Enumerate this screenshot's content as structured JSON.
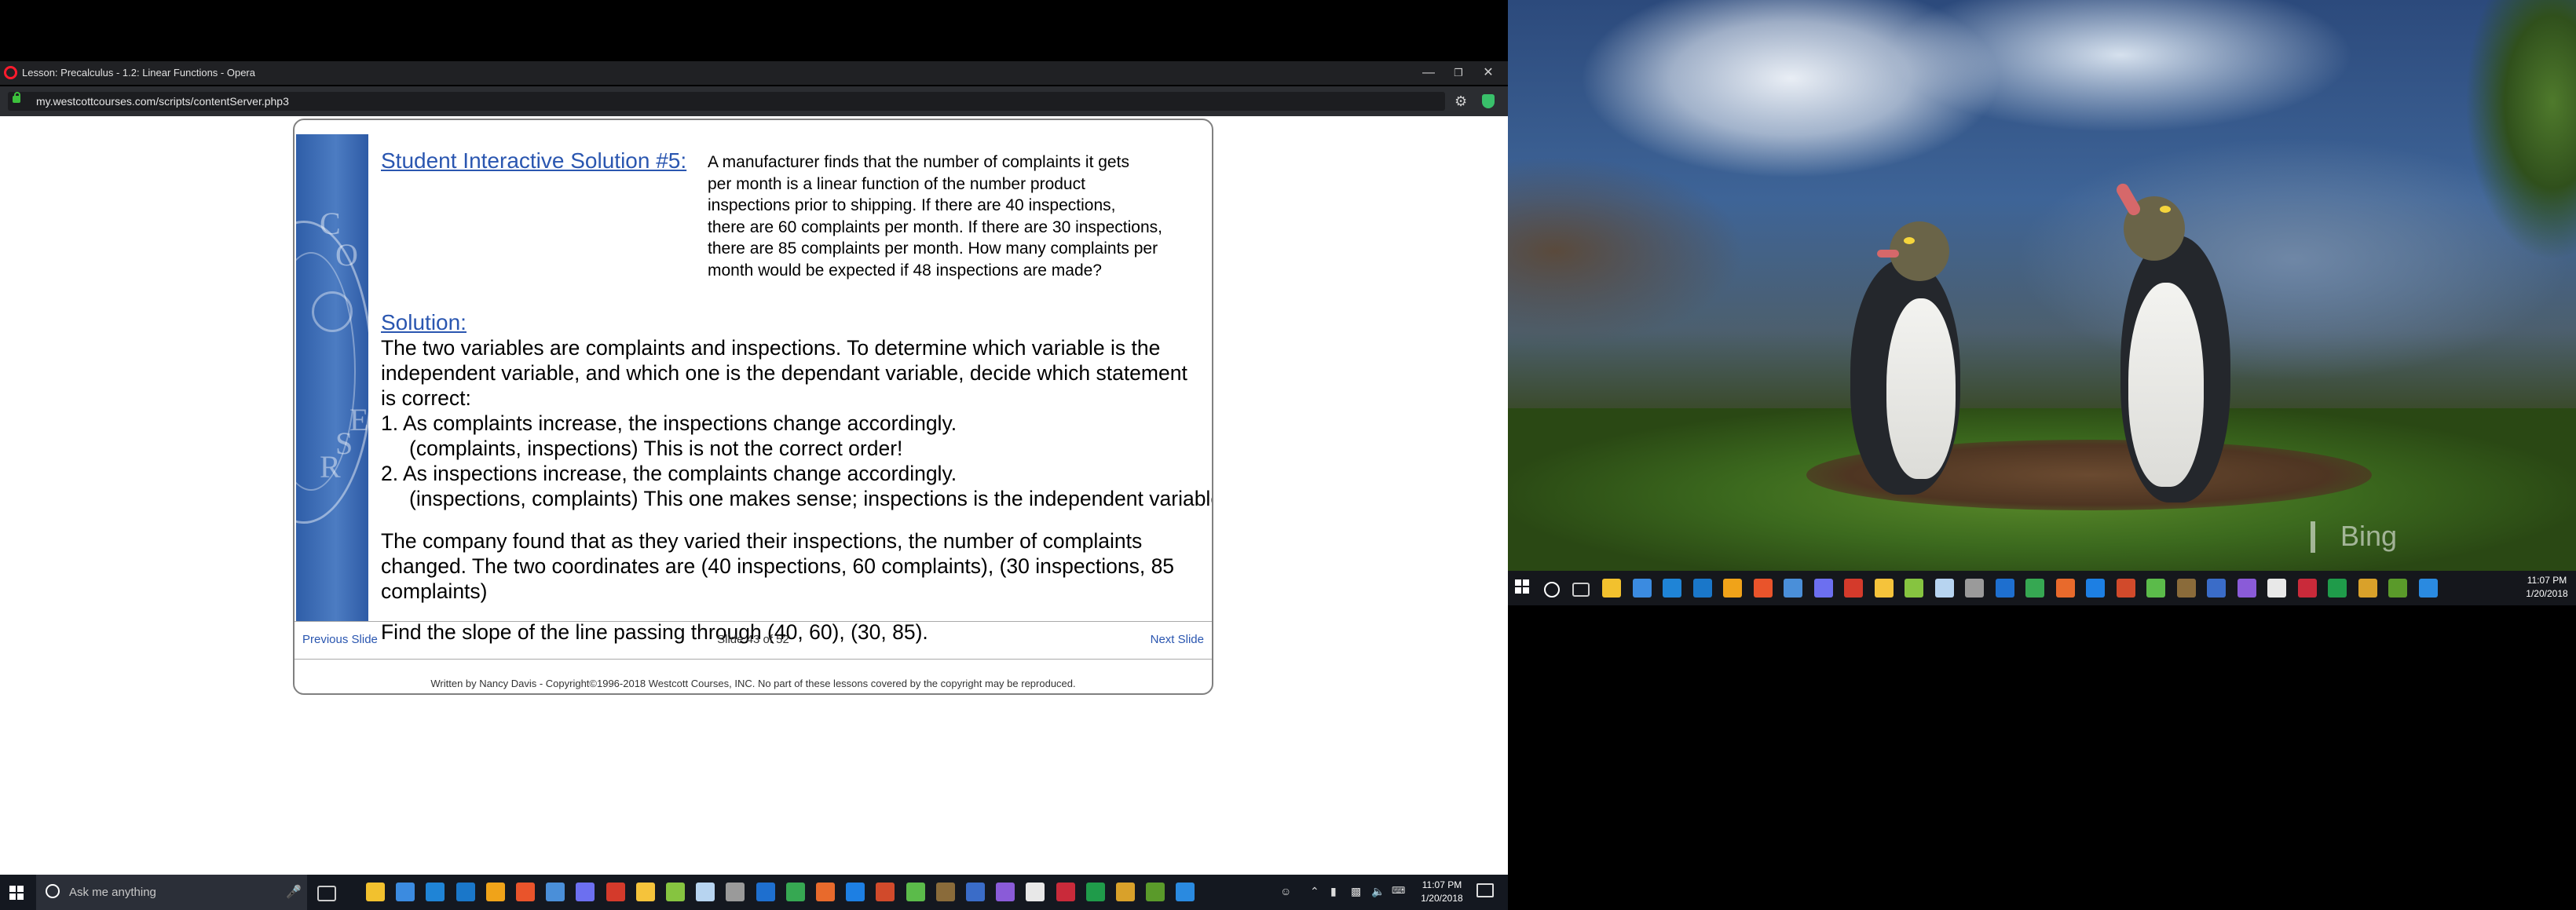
{
  "window": {
    "title": "Lesson: Precalculus - 1.2: Linear Functions - Opera",
    "url": "my.westcottcourses.com/scripts/contentServer.php3"
  },
  "lesson": {
    "sis_title": "Student Interactive Solution #5:",
    "problem_lines": [
      "A manufacturer finds that the number of complaints it gets",
      "per month is a linear function of the number product",
      "inspections prior to shipping.  If there are 40 inspections,",
      "there are 60 complaints per month.  If there are 30 inspections,",
      "there are 85 complaints per month.  How many complaints per",
      "month would be expected if 48 inspections are made?"
    ],
    "solution_label": "Solution:",
    "intro_lines": [
      "The two variables are complaints and inspections.  To determine which variable is the",
      "independent variable, and which one is the dependant variable, decide which statement",
      "is correct:"
    ],
    "option1": "1.  As complaints increase, the inspections change accordingly.",
    "option1_note": "(complaints, inspections)  This is not the correct order!",
    "option2": "2.  As inspections increase, the complaints change accordingly.",
    "option2_note": "(inspections, complaints) This one makes sense; inspections is the independent variable.",
    "company_lines": [
      "The company found that as they varied their inspections, the number of complaints",
      "changed.  The two coordinates are (40 inspections, 60 complaints), (30 inspections, 85",
      "complaints)"
    ],
    "find_slope": "Find the slope of the line passing through (40, 60), (30, 85)."
  },
  "nav": {
    "previous": "Previous Slide",
    "slide_counter": "Slide 43 of 52",
    "next": "Next Slide"
  },
  "footer": {
    "copyright": "Written by Nancy Davis - Copyright©1996-2018 Westcott Courses, INC. No part of these lessons covered by the copyright may be reproduced."
  },
  "taskbar": {
    "search_placeholder": "Ask me anything",
    "time": "11:07 PM",
    "date": "1/20/2018"
  },
  "right_screen": {
    "watermark": "Bing",
    "time": "11:07 PM",
    "date": "1/20/2018"
  },
  "icon_colors": [
    "#f2c12e",
    "#3b8be0",
    "#1f84d6",
    "#1a77c9",
    "#f0a319",
    "#e9542b",
    "#4a8fd9",
    "#6c6ff0",
    "#d43a2b",
    "#f5c33b",
    "#86c440",
    "#b7d4f0",
    "#9a9a9a",
    "#1e6fcf",
    "#36a852",
    "#e86a2c",
    "#1d7fe3",
    "#d14a2b",
    "#5bbb4a",
    "#8a6b3a",
    "#3a6cc8",
    "#8a5bd8",
    "#e8e8e8",
    "#c92a3a",
    "#1f9b4a",
    "#d9a12a",
    "#5a9a2a",
    "#2a8ae0"
  ]
}
